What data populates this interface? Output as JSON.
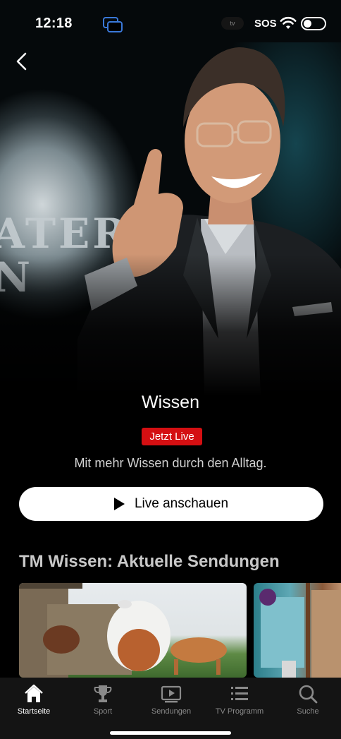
{
  "status_bar": {
    "time": "12:18",
    "tv_label": "tv",
    "sos": "SOS"
  },
  "hero": {
    "logo_text_line1": "ATER",
    "logo_text_line2": "N"
  },
  "show": {
    "title": "Wissen",
    "live_badge": "Jetzt Live",
    "subtitle": "Mit mehr Wissen durch den Alltag.",
    "watch_button": "Live anschauen"
  },
  "section": {
    "title": "TM Wissen: Aktuelle Sendungen"
  },
  "tabs": [
    {
      "label": "Startseite",
      "icon": "home-icon",
      "active": true
    },
    {
      "label": "Sport",
      "icon": "trophy-icon",
      "active": false
    },
    {
      "label": "Sendungen",
      "icon": "play-box-icon",
      "active": false
    },
    {
      "label": "TV Programm",
      "icon": "list-icon",
      "active": false
    },
    {
      "label": "Suche",
      "icon": "search-icon",
      "active": false
    }
  ],
  "colors": {
    "live": "#d40f12",
    "background": "#000000",
    "tab_bar": "#141414"
  }
}
